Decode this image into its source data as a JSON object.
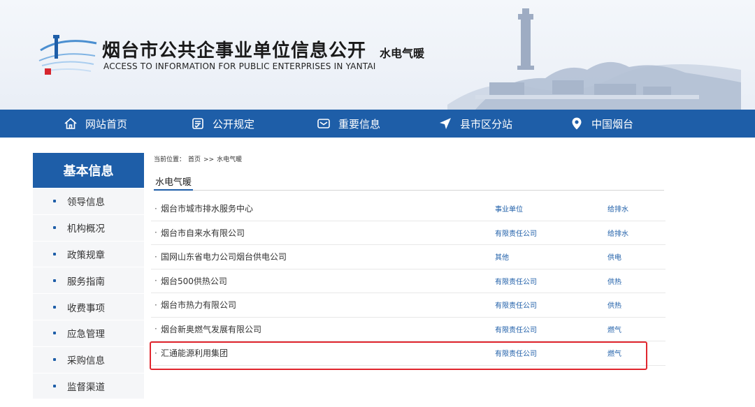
{
  "header": {
    "title": "烟台市公共企事业单位信息公开",
    "subtitle": "水电气暖",
    "english": "ACCESS TO INFORMATION FOR PUBLIC ENTERPRISES IN YANTAI"
  },
  "nav": [
    {
      "label": "网站首页",
      "icon": "home-icon"
    },
    {
      "label": "公开规定",
      "icon": "document-icon"
    },
    {
      "label": "重要信息",
      "icon": "mail-icon"
    },
    {
      "label": "县市区分站",
      "icon": "navigation-arrow-icon"
    },
    {
      "label": "中国烟台",
      "icon": "location-pin-icon"
    }
  ],
  "sidebar": {
    "title": "基本信息",
    "items": [
      "领导信息",
      "机构概况",
      "政策规章",
      "服务指南",
      "收费事项",
      "应急管理",
      "采购信息",
      "监督渠道"
    ]
  },
  "breadcrumb": {
    "prefix": "当前位置：",
    "home": "首页",
    "separator": ">>",
    "current": "水电气暖"
  },
  "section_tab": "水电气暖",
  "list": {
    "rows": [
      {
        "name": "烟台市城市排水服务中心",
        "type": "事业单位",
        "category": "给排水"
      },
      {
        "name": "烟台市自来水有限公司",
        "type": "有限责任公司",
        "category": "给排水"
      },
      {
        "name": "国网山东省电力公司烟台供电公司",
        "type": "其他",
        "category": "供电"
      },
      {
        "name": "烟台500供热公司",
        "type": "有限责任公司",
        "category": "供热"
      },
      {
        "name": "烟台市热力有限公司",
        "type": "有限责任公司",
        "category": "供热"
      },
      {
        "name": "烟台新奥燃气发展有限公司",
        "type": "有限责任公司",
        "category": "燃气"
      },
      {
        "name": "汇通能源利用集团",
        "type": "有限责任公司",
        "category": "燃气"
      }
    ]
  },
  "colors": {
    "brand_blue": "#1e5ea8",
    "highlight_red": "#e0262e"
  }
}
